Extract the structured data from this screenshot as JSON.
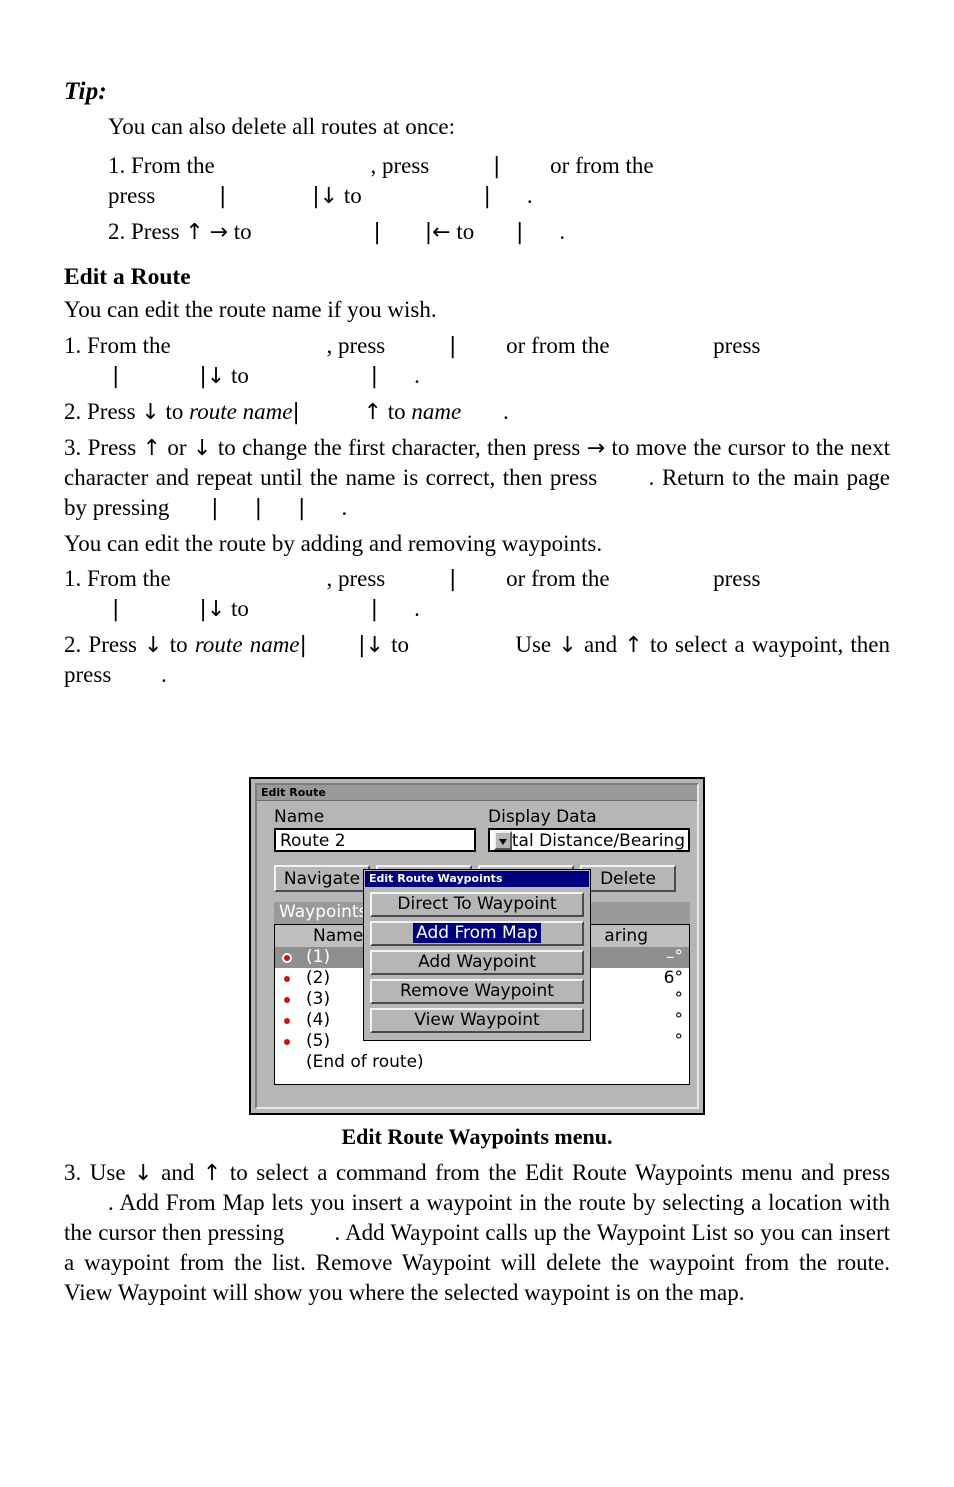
{
  "page": {
    "tip": {
      "heading": "Tip:",
      "body": "You can also delete all routes at once:",
      "steps": [
        {
          "num": "1.",
          "seg_a": "From the",
          "seg_b": ", press",
          "seg_c": "or from the",
          "seg_d": "press",
          "seg_e": "to",
          "seg_f": "."
        },
        {
          "num": "2.",
          "seg_a": "Press",
          "seg_b": "to",
          "seg_c": "to",
          "seg_d": "."
        }
      ]
    },
    "section_heading": "Edit a Route",
    "intro": "You can edit the route name if you wish.",
    "name_steps": [
      {
        "num": "1.",
        "seg_a": "From the",
        "seg_b": ", press",
        "seg_c": "or from the",
        "seg_d": "press",
        "seg_e": "to",
        "seg_f": "."
      },
      {
        "num": "2.",
        "seg_a": "Press",
        "seg_b": "to",
        "italic_1": "route name",
        "seg_c": "to",
        "italic_2": "name",
        "seg_d": "."
      },
      {
        "num": "3.",
        "text_1": "Press",
        "text_2": "or",
        "text_3": "to change the first character, then press",
        "text_4": "to move the cursor to the next character and repeat until the name is correct, then press",
        "text_5": ". Return to the main page by pressing",
        "text_6": "."
      }
    ],
    "waypoint_intro": "You can edit the route by adding and removing waypoints.",
    "waypoint_steps": [
      {
        "num": "1.",
        "seg_a": "From the",
        "seg_b": ", press",
        "seg_c": "or from the",
        "seg_d": "press",
        "seg_e": "to",
        "seg_f": "."
      },
      {
        "num": "2.",
        "seg_a": "Press",
        "seg_b": "to",
        "italic_1": "route name",
        "seg_c": "to",
        "seg_d": "Use",
        "seg_e": "and",
        "seg_f": "to select a waypoint, then press",
        "seg_g": "."
      }
    ],
    "figure_caption": "Edit Route Waypoints menu.",
    "final_step": {
      "num": "3.",
      "text_1": "Use",
      "text_2": "and",
      "text_3": "to select a command from the Edit Route Waypoints menu and press",
      "text_4": ". Add From Map lets you insert a waypoint in the route by selecting a location with the cursor then pressing",
      "text_5": ". Add Waypoint calls up the Waypoint List so you can insert a waypoint from the list. Remove Waypoint will delete the waypoint from the route. View Waypoint will show you where the selected waypoint is on the map."
    },
    "arrows": {
      "up": "↑",
      "down": "↓",
      "left": "←",
      "right": "→",
      "pipe": "|"
    }
  },
  "device_screenshot": {
    "window_title": "Edit Route",
    "name_label": "Name",
    "name_value": "Route 2",
    "display_data_label": "Display Data",
    "display_data_value": "Total Distance/Bearing",
    "buttons": {
      "navigate": "Navigate",
      "delete": "Delete"
    },
    "waypoints_header": "Waypoints",
    "columns": {
      "name": "Name",
      "bearing": "aring"
    },
    "rows": [
      {
        "name": "(1)",
        "bearing": "–°",
        "selected": true
      },
      {
        "name": "(2)",
        "bearing": "6°",
        "selected": false
      },
      {
        "name": "(3)",
        "bearing": "°",
        "selected": false
      },
      {
        "name": "(4)",
        "bearing": "°",
        "selected": false
      },
      {
        "name": "(5)",
        "bearing": "°",
        "selected": false
      }
    ],
    "end_of_route": "(End of route)",
    "popup": {
      "title": "Edit Route Waypoints",
      "items": [
        {
          "label": "Direct To Waypoint",
          "highlighted": false
        },
        {
          "label": "Add From Map",
          "highlighted": true
        },
        {
          "label": "Add Waypoint",
          "highlighted": false
        },
        {
          "label": "Remove Waypoint",
          "highlighted": false
        },
        {
          "label": "View Waypoint",
          "highlighted": false
        }
      ]
    },
    "colors": {
      "chrome": "#b6b6b6",
      "title_bar": "#9a9a9a",
      "popup_title_bar": "#00007e",
      "highlight": "#00007e",
      "selected_row": "#8f8f8f",
      "waypoint_dot": "#cc1111"
    }
  }
}
